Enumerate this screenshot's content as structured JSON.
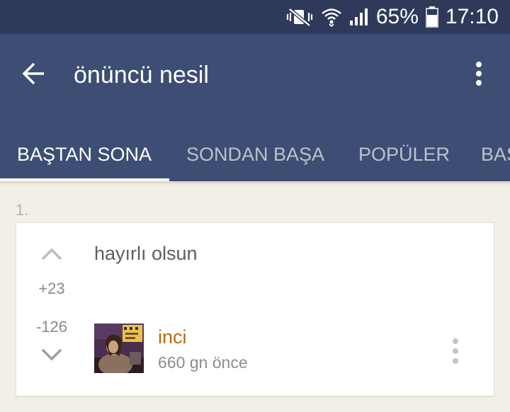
{
  "status_bar": {
    "battery": "65%",
    "time": "17:10",
    "icons": [
      "mute-vibrate-icon",
      "wifi-icon",
      "signal-icon",
      "battery-icon"
    ]
  },
  "app_bar": {
    "title": "önüncü nesil",
    "back_icon": "arrow-left-icon",
    "more_icon": "more-vertical-icon"
  },
  "tabs": [
    {
      "label": "BAŞTAN SONA",
      "active": true
    },
    {
      "label": "SONDAN BAŞA",
      "active": false
    },
    {
      "label": "POPÜLER",
      "active": false
    },
    {
      "label": "BAŞ",
      "active": false
    }
  ],
  "entry": {
    "number": "1.",
    "text": "hayırlı olsun",
    "upvotes": "+23",
    "downvotes": "-126",
    "author": "inci",
    "time_ago": "660 gn  önce"
  },
  "colors": {
    "status_bar": "#2f3a5a",
    "app_bar": "#3e4d73",
    "background": "#f2f0e6",
    "author": "#b86a18"
  }
}
